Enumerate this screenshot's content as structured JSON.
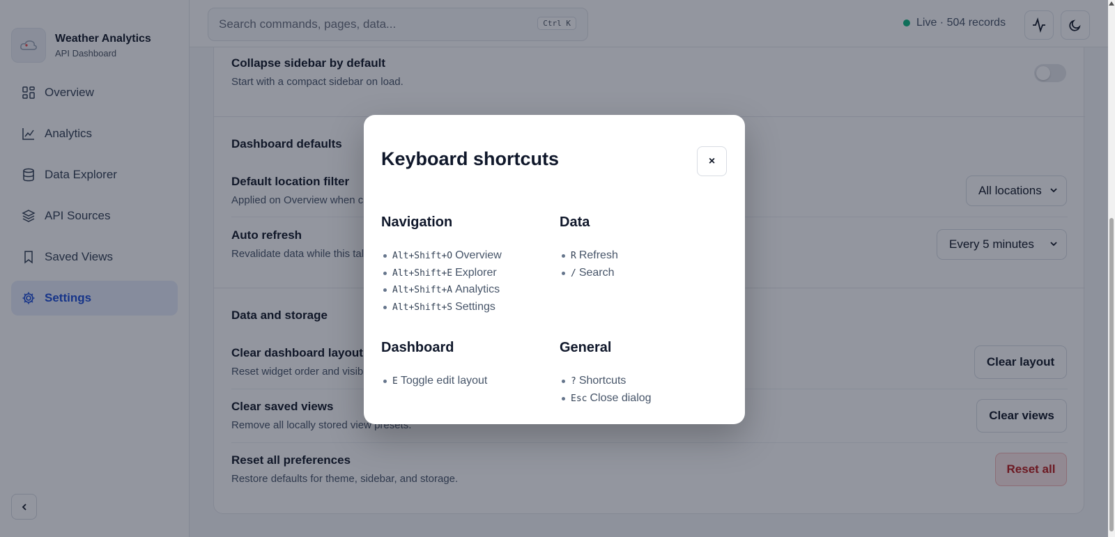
{
  "brand": {
    "title": "Weather Analytics",
    "subtitle": "API Dashboard"
  },
  "sidebar": {
    "items": [
      {
        "label": "Overview",
        "icon": "grid-icon",
        "active": false
      },
      {
        "label": "Analytics",
        "icon": "chart-line-icon",
        "active": false
      },
      {
        "label": "Data Explorer",
        "icon": "database-icon",
        "active": false
      },
      {
        "label": "API Sources",
        "icon": "layers-icon",
        "active": false
      },
      {
        "label": "Saved Views",
        "icon": "bookmark-icon",
        "active": false
      },
      {
        "label": "Settings",
        "icon": "gear-icon",
        "active": true
      }
    ]
  },
  "topbar": {
    "search_placeholder": "Search commands, pages, data...",
    "search_shortcut": "Ctrl K",
    "live_status": "Live · 504 records"
  },
  "settings": {
    "collapse_title": "Collapse sidebar by default",
    "collapse_desc": "Start with a compact sidebar on load.",
    "collapse_enabled": false,
    "dashboard_defaults_title": "Dashboard defaults",
    "location_title": "Default location filter",
    "location_desc": "Applied on Overview when c",
    "location_value": "All locations",
    "refresh_title": "Auto refresh",
    "refresh_desc": "Revalidate data while this tal",
    "refresh_value": "Every 5 minutes",
    "storage_title": "Data and storage",
    "clear_layout_title": "Clear dashboard layout",
    "clear_layout_desc": "Reset widget order and visib",
    "clear_layout_button": "Clear layout",
    "clear_views_title": "Clear saved views",
    "clear_views_desc": "Remove all locally stored view presets.",
    "clear_views_button": "Clear views",
    "reset_title": "Reset all preferences",
    "reset_desc": "Restore defaults for theme, sidebar, and storage.",
    "reset_button": "Reset all"
  },
  "modal": {
    "title": "Keyboard shortcuts",
    "close_label": "×",
    "groups": [
      {
        "title": "Navigation",
        "items": [
          {
            "keys": "Alt+Shift+O",
            "label": "Overview"
          },
          {
            "keys": "Alt+Shift+E",
            "label": "Explorer"
          },
          {
            "keys": "Alt+Shift+A",
            "label": "Analytics"
          },
          {
            "keys": "Alt+Shift+S",
            "label": "Settings"
          }
        ]
      },
      {
        "title": "Data",
        "items": [
          {
            "keys": "R",
            "label": "Refresh"
          },
          {
            "keys": "/",
            "label": "Search"
          }
        ]
      },
      {
        "title": "Dashboard",
        "items": [
          {
            "keys": "E",
            "label": "Toggle edit layout"
          }
        ]
      },
      {
        "title": "General",
        "items": [
          {
            "keys": "?",
            "label": "Shortcuts"
          },
          {
            "keys": "Esc",
            "label": "Close dialog"
          }
        ]
      }
    ]
  },
  "colors": {
    "accent": "#1d4ed8",
    "live": "#10b981",
    "danger": "#b91c1c"
  }
}
